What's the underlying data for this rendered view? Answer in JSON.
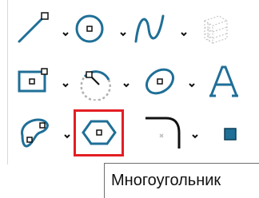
{
  "tooltip": {
    "text": "Многоугольник"
  },
  "tools": [
    {
      "name": "line-tool",
      "icon": "line-icon",
      "has_dropdown": true
    },
    {
      "name": "circle-tool",
      "icon": "circle-icon",
      "has_dropdown": true
    },
    {
      "name": "spline-tool",
      "icon": "spline-icon",
      "has_dropdown": true
    },
    {
      "name": "grid-tool",
      "icon": "grid-icon",
      "has_dropdown": false,
      "disabled": true
    },
    {
      "name": "rectangle-tool",
      "icon": "rectangle-icon",
      "has_dropdown": true
    },
    {
      "name": "arc-tool",
      "icon": "arc-icon",
      "has_dropdown": true
    },
    {
      "name": "ellipse-tool",
      "icon": "ellipse-icon",
      "has_dropdown": true
    },
    {
      "name": "text-tool",
      "icon": "text-a-icon",
      "has_dropdown": false
    },
    {
      "name": "freeform-tool",
      "icon": "freeform-icon",
      "has_dropdown": true
    },
    {
      "name": "polygon-tool",
      "icon": "hexagon-icon",
      "has_dropdown": false,
      "selected": true
    },
    {
      "name": "fillet-tool",
      "icon": "fillet-icon",
      "has_dropdown": true
    },
    {
      "name": "point-tool",
      "icon": "square-point-icon",
      "has_dropdown": false
    }
  ],
  "colors": {
    "icon_blue": "#1f6f97",
    "selection_red": "#e31e24",
    "disabled_gray": "#c7c7c7",
    "text": "#111111"
  }
}
